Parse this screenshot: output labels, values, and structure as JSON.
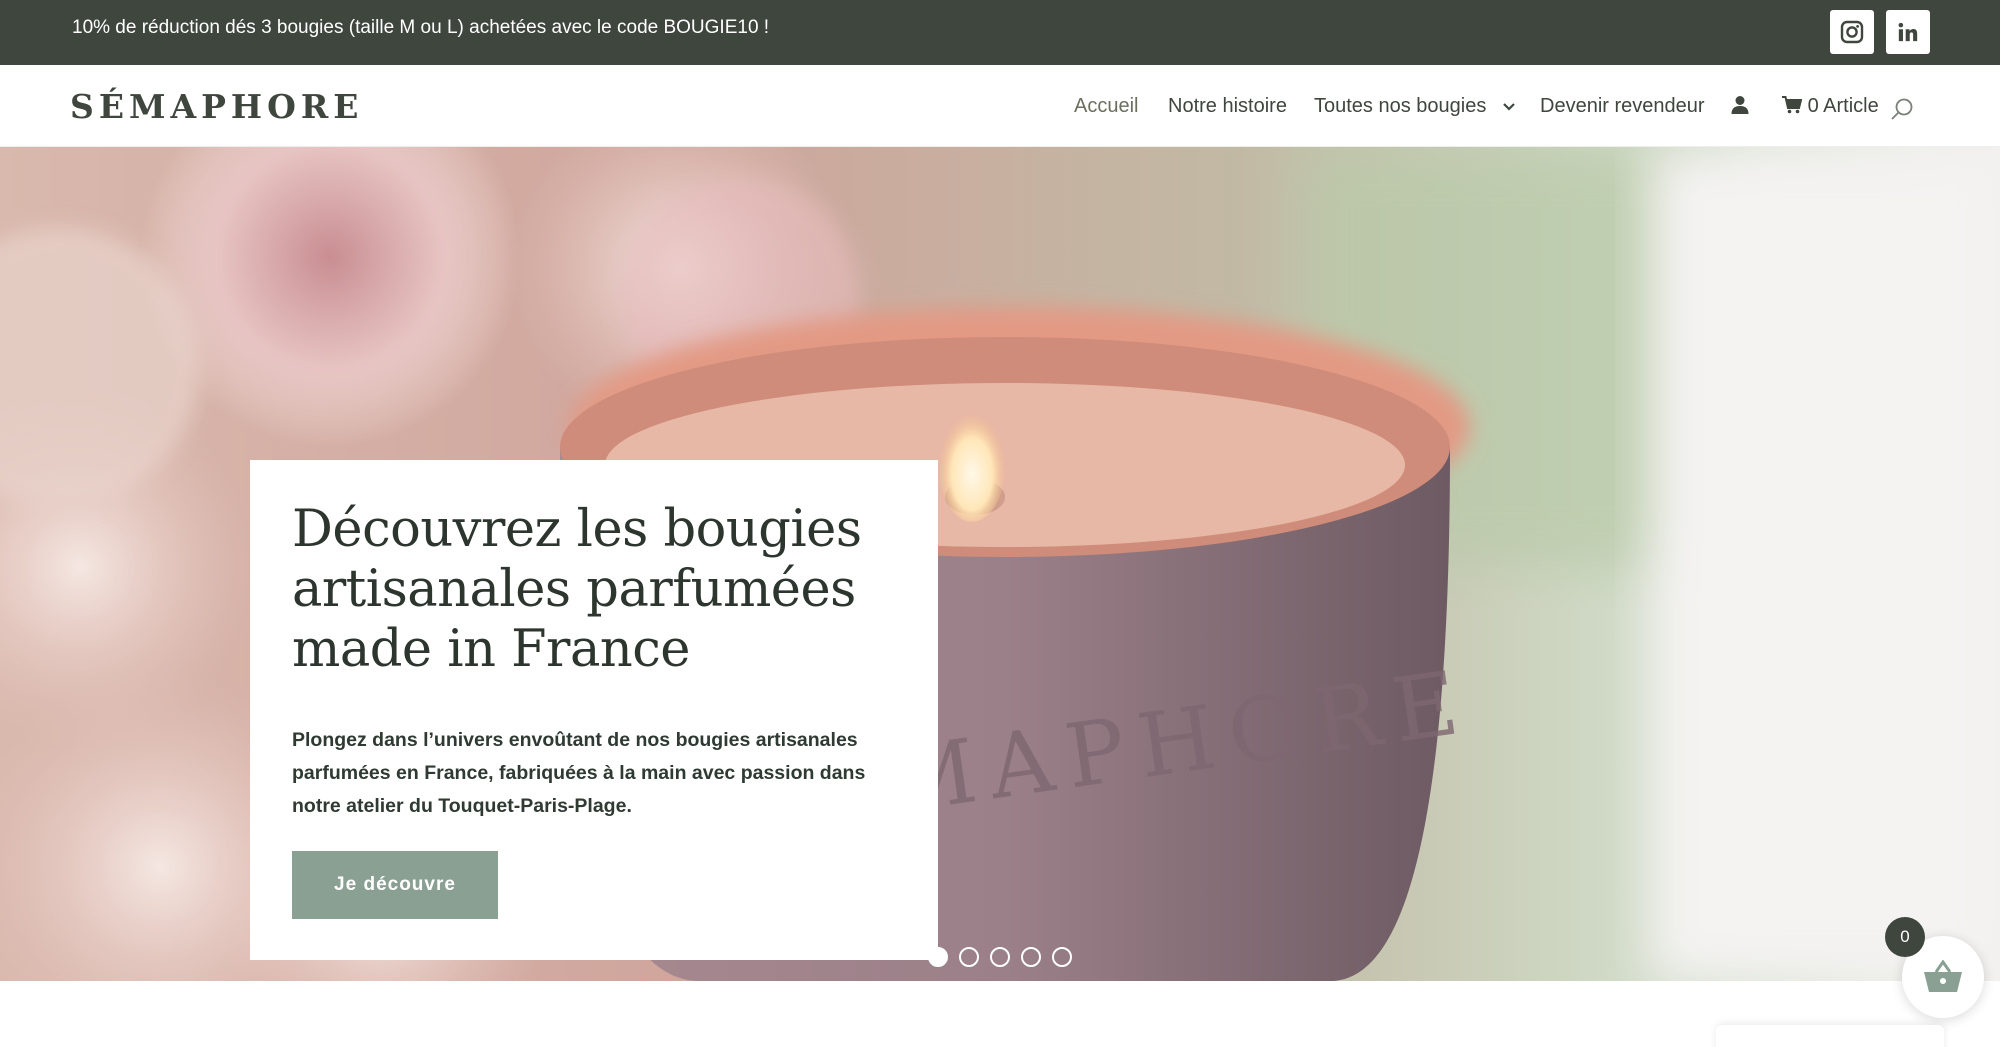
{
  "promo_bar": {
    "text": "10% de réduction dés 3 bougies (taille M ou L) achetées avec le code BOUGIE10 !",
    "social": [
      {
        "icon": "instagram-icon"
      },
      {
        "icon": "linkedin-icon"
      }
    ]
  },
  "header": {
    "logo": "SÉMAPHORE",
    "nav": {
      "home": "Accueil",
      "story": "Notre histoire",
      "candles": "Toutes nos bougies",
      "reseller": "Devenir revendeur",
      "account_icon": "user-icon",
      "cart": "0 Article",
      "search_icon": "search-icon"
    }
  },
  "hero": {
    "title": "Découvrez les bougies artisanales parfumées made in France",
    "text": "Plongez dans l’univers envoûtant de nos bougies artisanales parfumées en France, fabriquées à la main avec passion dans notre atelier du Touquet-Paris-Plage.",
    "cta": "Je découvre",
    "candle_engraving": "SÉMAPHORE",
    "slides": 5,
    "active_slide": 1
  },
  "basket_widget": {
    "count": "0",
    "icon": "basket-icon"
  },
  "colors": {
    "topbar": "#3e463e",
    "cta": "#89a093",
    "text_dark": "#2d352f"
  }
}
